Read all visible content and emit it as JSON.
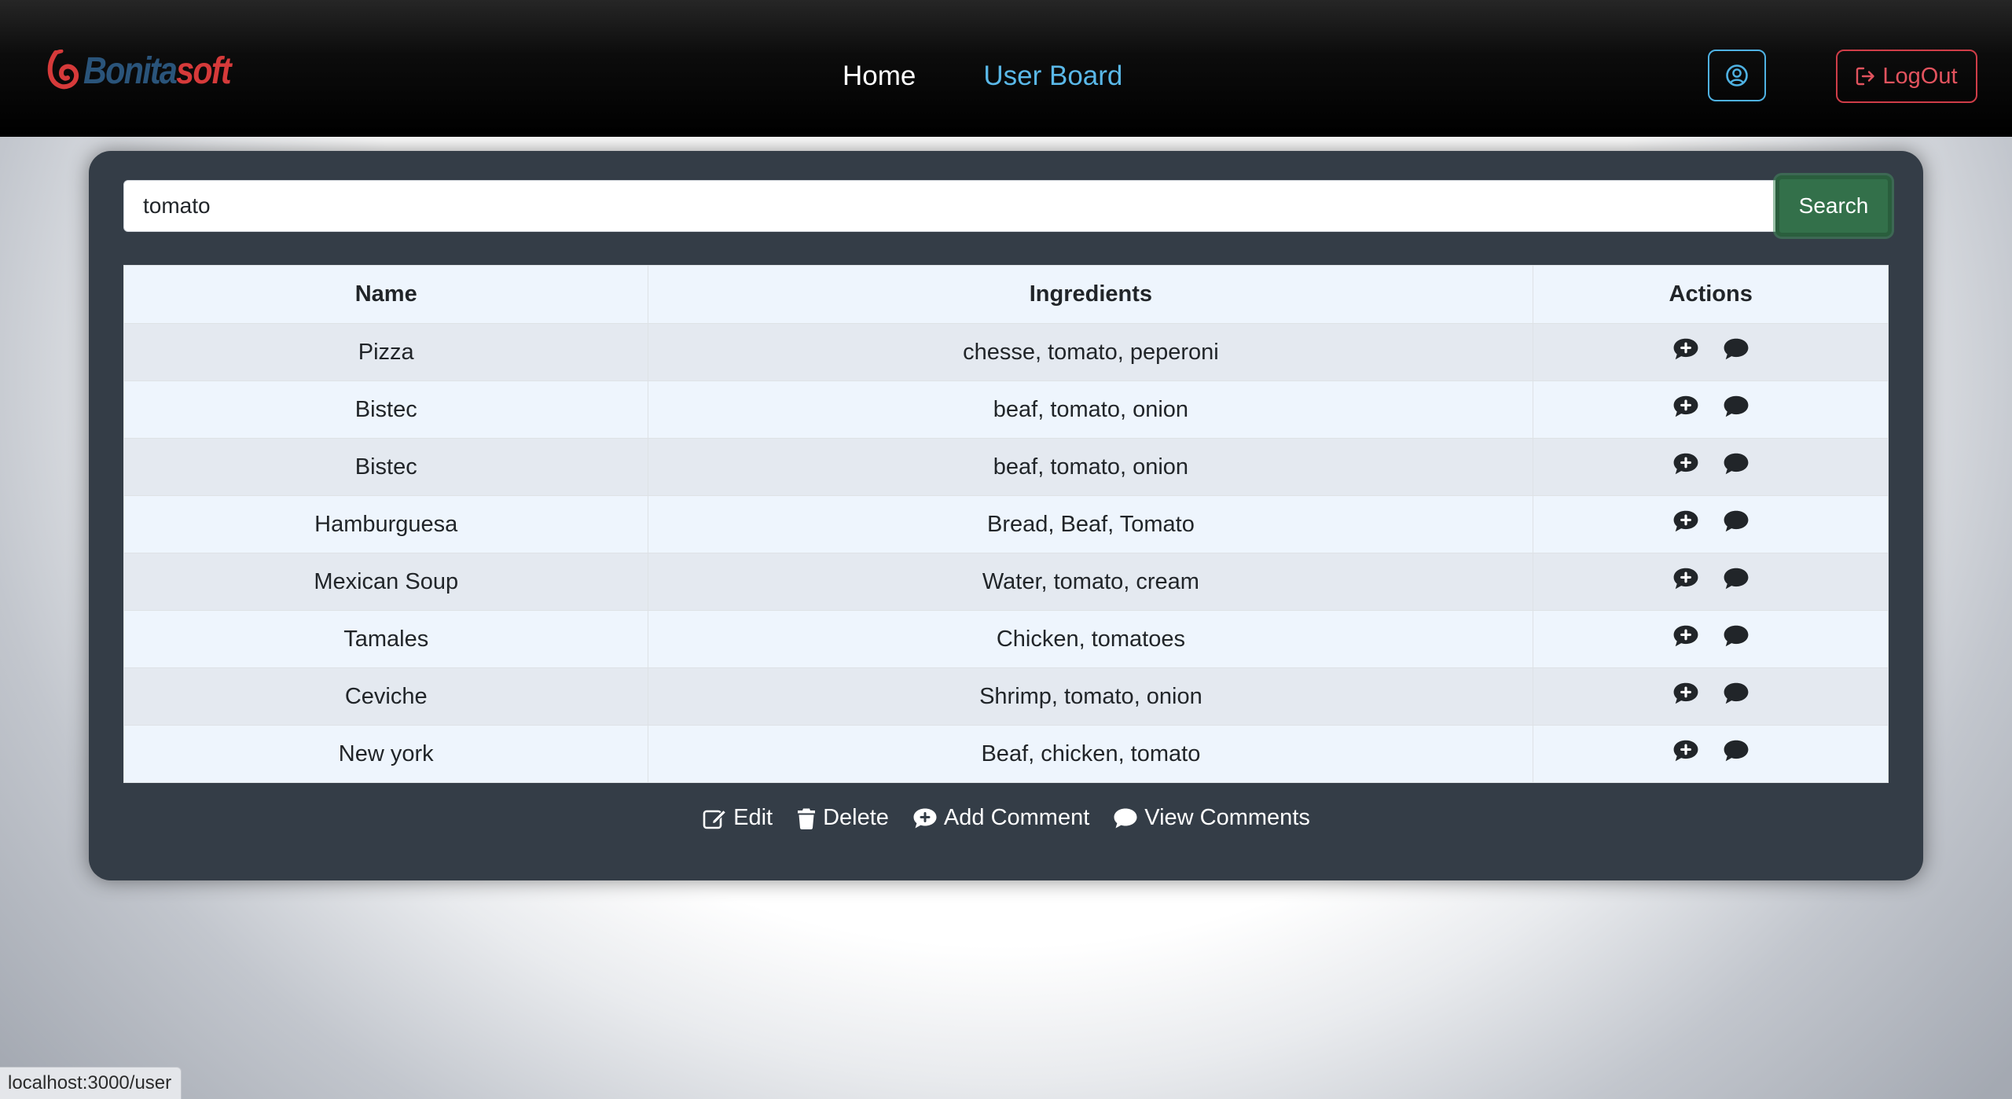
{
  "navbar": {
    "brand": {
      "part1": "Bonita",
      "part2": "soft"
    },
    "links": [
      {
        "label": "Home"
      },
      {
        "label": "User Board"
      }
    ],
    "logout_label": "LogOut"
  },
  "search": {
    "value": "tomato",
    "button_label": "Search"
  },
  "table": {
    "headers": [
      "Name",
      "Ingredients",
      "Actions"
    ],
    "rows": [
      {
        "name": "Pizza",
        "ingredients": "chesse, tomato, peperoni"
      },
      {
        "name": "Bistec",
        "ingredients": "beaf, tomato, onion"
      },
      {
        "name": "Bistec",
        "ingredients": "beaf, tomato, onion"
      },
      {
        "name": "Hamburguesa",
        "ingredients": "Bread, Beaf, Tomato"
      },
      {
        "name": "Mexican Soup",
        "ingredients": "Water, tomato, cream"
      },
      {
        "name": "Tamales",
        "ingredients": "Chicken, tomatoes"
      },
      {
        "name": "Ceviche",
        "ingredients": "Shrimp, tomato, onion"
      },
      {
        "name": "New york",
        "ingredients": "Beaf, chicken, tomato"
      }
    ]
  },
  "legend": {
    "edit": "Edit",
    "delete": "Delete",
    "add_comment": "Add Comment",
    "view_comments": "View Comments"
  },
  "status_url": "localhost:3000/user",
  "colors": {
    "accent_blue": "#5ab8e8",
    "logout_red": "#e2535e",
    "search_green": "#33704a",
    "panel": "#343d47"
  }
}
